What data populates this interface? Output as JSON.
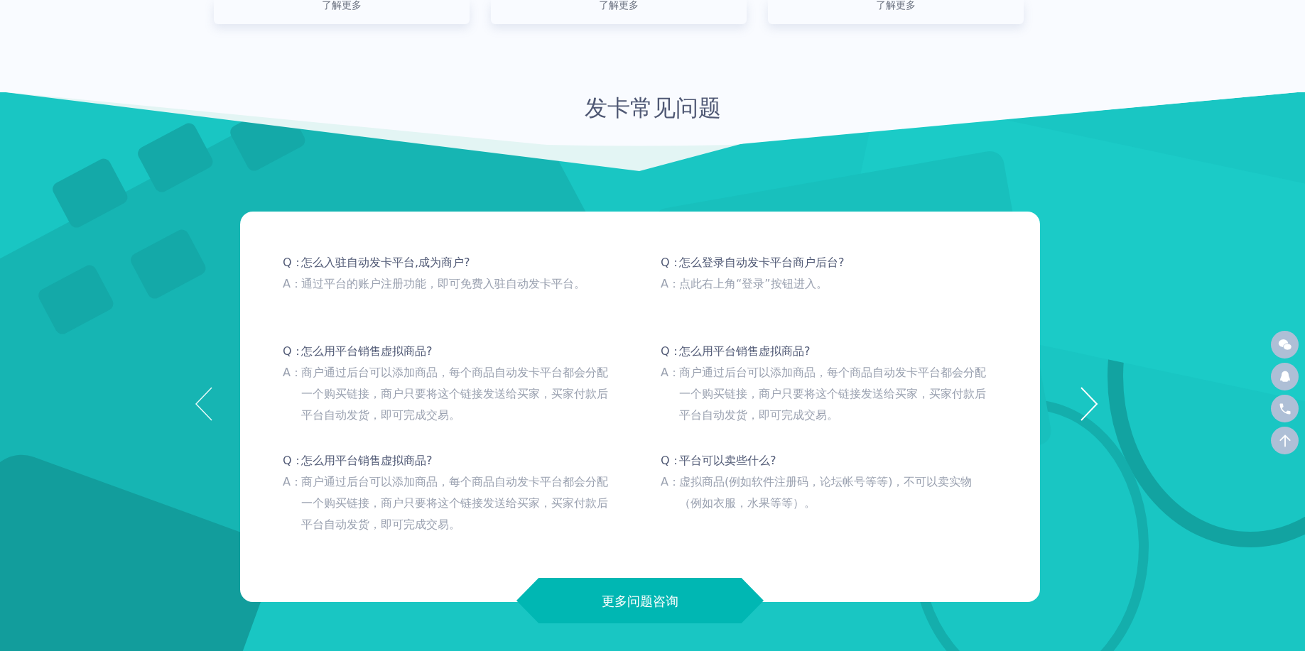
{
  "cards": [
    {
      "link": "了解更多"
    },
    {
      "link": "了解更多"
    },
    {
      "link": "了解更多"
    }
  ],
  "faq": {
    "title": "发卡常见问题",
    "items": [
      {
        "q_label": "Q：",
        "question": "怎么入驻自动发卡平台,成为商户?",
        "a_label": "A：",
        "answer": "通过平台的账户注册功能，即可免费入驻自动发卡平台。"
      },
      {
        "q_label": "Q：",
        "question": "怎么登录自动发卡平台商户后台?",
        "a_label": "A：",
        "answer": "点此右上角“登录”按钮进入。"
      },
      {
        "q_label": "Q：",
        "question": "怎么用平台销售虚拟商品?",
        "a_label": "A：",
        "answer": "商户通过后台可以添加商品，每个商品自动发卡平台都会分配一个购买链接，商户只要将这个链接发送给买家，买家付款后平台自动发货，即可完成交易。"
      },
      {
        "q_label": "Q：",
        "question": "怎么用平台销售虚拟商品?",
        "a_label": "A：",
        "answer": "商户通过后台可以添加商品，每个商品自动发卡平台都会分配一个购买链接，商户只要将这个链接发送给买家，买家付款后平台自动发货，即可完成交易。"
      },
      {
        "q_label": "Q：",
        "question": "怎么用平台销售虚拟商品?",
        "a_label": "A：",
        "answer": "商户通过后台可以添加商品，每个商品自动发卡平台都会分配一个购买链接，商户只要将这个链接发送给买家，买家付款后平台自动发货，即可完成交易。"
      },
      {
        "q_label": "Q：",
        "question": "平台可以卖些什么?",
        "a_label": "A：",
        "answer": "虚拟商品(例如软件注册码，论坛帐号等等)，不可以卖实物（例如衣服，水果等等）。"
      }
    ],
    "more_button": "更多问题咨询"
  },
  "side_buttons": [
    {
      "kind": "chat"
    },
    {
      "kind": "penguin"
    },
    {
      "kind": "phone"
    },
    {
      "kind": "top"
    }
  ]
}
